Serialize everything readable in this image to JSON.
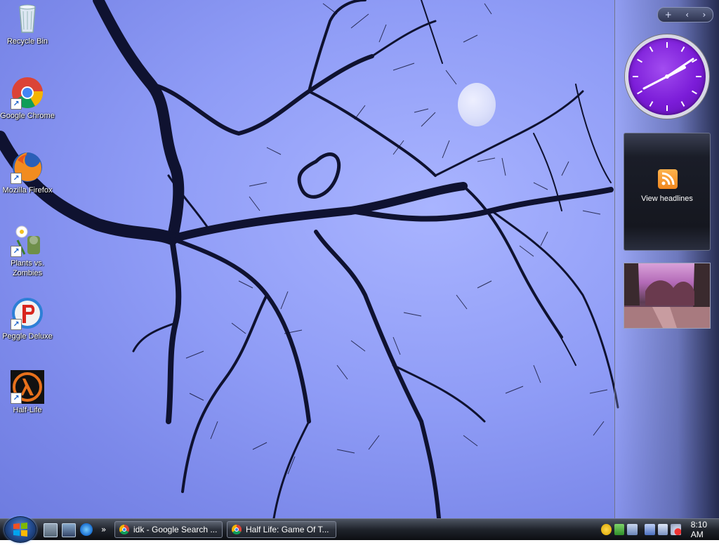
{
  "desktop_icons": [
    {
      "label": "Recycle Bin",
      "icon": "recycle-bin-icon"
    },
    {
      "label": "Google Chrome",
      "icon": "chrome-icon"
    },
    {
      "label": "Mozilla Firefox",
      "icon": "firefox-icon"
    },
    {
      "label": "Plants vs. Zombies",
      "icon": "plants-vs-zombies-icon"
    },
    {
      "label": "Peggle Deluxe",
      "icon": "peggle-icon"
    },
    {
      "label": "Half-Life",
      "icon": "half-life-icon"
    }
  ],
  "sidebar": {
    "controls": {
      "add": "+",
      "prev": "‹",
      "next": "›"
    },
    "feed_gadget": {
      "label": "View headlines",
      "icon": "rss-icon"
    },
    "clock_gadget": {
      "icon": "analog-clock-icon"
    },
    "slideshow_gadget": {
      "icon": "slideshow-photo"
    }
  },
  "taskbar": {
    "start_icon": "windows-start-icon",
    "quick_launch": [
      "show-desktop-icon",
      "switch-windows-icon",
      "internet-explorer-icon"
    ],
    "overflow": "»",
    "tasks": [
      {
        "label": "idk - Google Search ...",
        "icon": "chrome-icon"
      },
      {
        "label": "Half Life: Game Of T...",
        "icon": "chrome-icon"
      }
    ],
    "tray_icons": [
      "security-warning-icon",
      "windows-defender-icon",
      "network-icon",
      "display-icon",
      "network-connection-icon",
      "volume-muted-icon"
    ],
    "clock": "8:10 AM"
  },
  "colors": {
    "sky": "#8f9cf6",
    "branches": "#0f1230",
    "clock_purple": "#7b1cd8",
    "rss_orange": "#f0871f",
    "taskbar": "#1f232b"
  }
}
